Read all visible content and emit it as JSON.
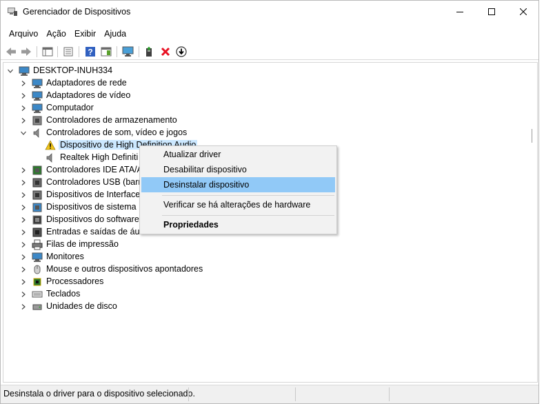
{
  "window": {
    "title": "Gerenciador de Dispositivos"
  },
  "menu": [
    "Arquivo",
    "Ação",
    "Exibir",
    "Ajuda"
  ],
  "toolbar": {
    "buttons": [
      "back-icon",
      "forward-icon",
      "properties-pane-icon",
      "list-icon",
      "help-icon",
      "action-pane-icon",
      "monitor-icon",
      "update-driver-icon",
      "uninstall-icon",
      "download-icon"
    ]
  },
  "tree": {
    "root": "DESKTOP-INUH334",
    "items": [
      {
        "label": "Adaptadores de rede",
        "icon": "network-adapter-icon",
        "expanded": false
      },
      {
        "label": "Adaptadores de vídeo",
        "icon": "display-adapter-icon",
        "expanded": false
      },
      {
        "label": "Computador",
        "icon": "computer-icon",
        "expanded": false
      },
      {
        "label": "Controladores de armazenamento",
        "icon": "storage-controller-icon",
        "expanded": false
      },
      {
        "label": "Controladores de som, vídeo e jogos",
        "icon": "speaker-icon",
        "expanded": true
      },
      {
        "label": "Dispositivo de High Definition Audio",
        "icon": "warning-icon",
        "child": true,
        "selected": true
      },
      {
        "label": "Realtek High Definiti",
        "icon": "speaker-icon",
        "child": true
      },
      {
        "label": "Controladores IDE ATA/AT",
        "icon": "ide-controller-icon",
        "expanded": false
      },
      {
        "label": "Controladores USB (barra",
        "icon": "usb-icon",
        "expanded": false
      },
      {
        "label": "Dispositivos de Interface H",
        "icon": "hid-icon",
        "expanded": false
      },
      {
        "label": "Dispositivos de sistema",
        "icon": "system-device-icon",
        "expanded": false
      },
      {
        "label": "Dispositivos do software",
        "icon": "software-device-icon",
        "expanded": false
      },
      {
        "label": "Entradas e saídas de áudio",
        "icon": "audio-io-icon",
        "expanded": false
      },
      {
        "label": "Filas de impressão",
        "icon": "printer-icon",
        "expanded": false
      },
      {
        "label": "Monitores",
        "icon": "monitor-icon",
        "expanded": false
      },
      {
        "label": "Mouse e outros dispositivos apontadores",
        "icon": "mouse-icon",
        "expanded": false
      },
      {
        "label": "Processadores",
        "icon": "processor-icon",
        "expanded": false
      },
      {
        "label": "Teclados",
        "icon": "keyboard-icon",
        "expanded": false
      },
      {
        "label": "Unidades de disco",
        "icon": "disk-drive-icon",
        "expanded": false
      }
    ]
  },
  "context_menu": {
    "items": [
      {
        "label": "Atualizar driver"
      },
      {
        "label": "Desabilitar dispositivo"
      },
      {
        "label": "Desinstalar dispositivo",
        "highlighted": true
      },
      {
        "label": "Verificar se há alterações de hardware"
      },
      {
        "label": "Propriedades",
        "bold": true
      }
    ]
  },
  "status": {
    "text": "Desinstala o driver para o dispositivo selecionado."
  },
  "colors": {
    "selection": "#cce8ff",
    "menu_hover": "#91c9f7",
    "warning": "#f0c419",
    "uninstall_red": "#e81123"
  }
}
